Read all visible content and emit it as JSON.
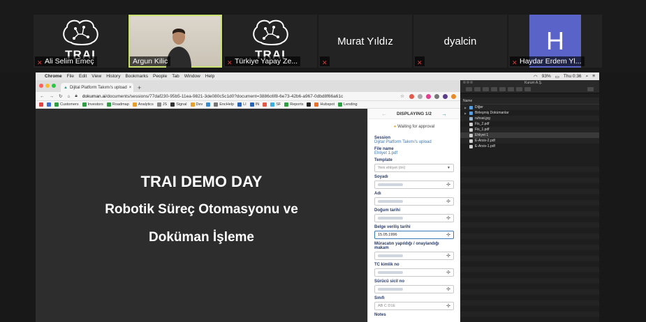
{
  "participants": [
    {
      "name": "Ali Selim Emeç",
      "type": "logo",
      "logo_text": "TRAI",
      "muted": true
    },
    {
      "name": "Argun Kilic",
      "type": "video",
      "muted": false,
      "active": true
    },
    {
      "name": "Türkiye Yapay Ze...",
      "type": "logo",
      "logo_text": "TRAI",
      "muted": true
    },
    {
      "name": "Murat Yıldız",
      "type": "name",
      "muted": true
    },
    {
      "name": "dyalcin",
      "type": "name",
      "muted": true
    },
    {
      "name": "Haydar Erdem Yl...",
      "type": "avatar",
      "initial": "H",
      "avatar_color": "#5a64c8",
      "muted": true
    }
  ],
  "menubar": {
    "apple": "",
    "app": "Chrome",
    "items": [
      "File",
      "Edit",
      "View",
      "History",
      "Bookmarks",
      "People",
      "Tab",
      "Window",
      "Help"
    ],
    "battery": "93%",
    "clock": "Thu 0:36"
  },
  "browser": {
    "tab_title": "Dijital Platform Takımı's upload",
    "url_host": "dokuman.ai",
    "url_path": "/documents/sessions/77daf230-95b5-11ea-9821-3de080c5c1d0?document=3886c6f8-6e73-42b6-a967-0dbd8f66a61c",
    "bookmarks": [
      "Customers",
      "Investors",
      "Roadmap",
      "Analytics",
      "JS",
      "Signal",
      "Dev",
      "EncHelp",
      "LI",
      "IN",
      "SF",
      "Reports",
      "Hubspot",
      "Lending"
    ]
  },
  "slide": {
    "title": "TRAI DEMO DAY",
    "line2": "Robotik Süreç Otomasyonu ve",
    "line3": "Doküman İşleme"
  },
  "panel": {
    "displaying": "DISPLAYING 1/2",
    "waiting": "Waiting for approval",
    "session_label": "Session",
    "session_value": "Dijital Platform Takımı's upload",
    "file_label": "File name",
    "file_value": "Ehliyet 1.pdf",
    "template_label": "Template",
    "template_value": "Yeni ehliyet (ön)",
    "fields": [
      {
        "label": "Soyadı",
        "value": ""
      },
      {
        "label": "Adı",
        "value": ""
      },
      {
        "label": "Doğum tarihi",
        "value": ""
      },
      {
        "label": "Belge veriliş tarihi",
        "value": "15.05.1996"
      },
      {
        "label": "Müracatın yapıldığı / onaylandığı makam",
        "value": ""
      },
      {
        "label": "TC kimlik no",
        "value": ""
      },
      {
        "label": "Sürücü sicil no",
        "value": ""
      },
      {
        "label": "Sınıfı",
        "value": "AB C D1E"
      }
    ],
    "notes_label": "Notes"
  },
  "finder": {
    "title": "Kurum A.Ş.",
    "column": "Name",
    "rows": [
      {
        "name": "Diğer",
        "kind": "folder"
      },
      {
        "name": "Birleşmiş Dokümanlar",
        "kind": "folder"
      },
      {
        "name": "ruhsat.jpg",
        "kind": "img"
      },
      {
        "name": "Fis_2.pdf",
        "kind": "file"
      },
      {
        "name": "Fis_1.pdf",
        "kind": "file"
      },
      {
        "name": "Ehliyet 1",
        "kind": "file",
        "selected": true
      },
      {
        "name": "E-Arsiv-2.pdf",
        "kind": "file"
      },
      {
        "name": "E-Arsiv-1.pdf",
        "kind": "file"
      }
    ]
  }
}
